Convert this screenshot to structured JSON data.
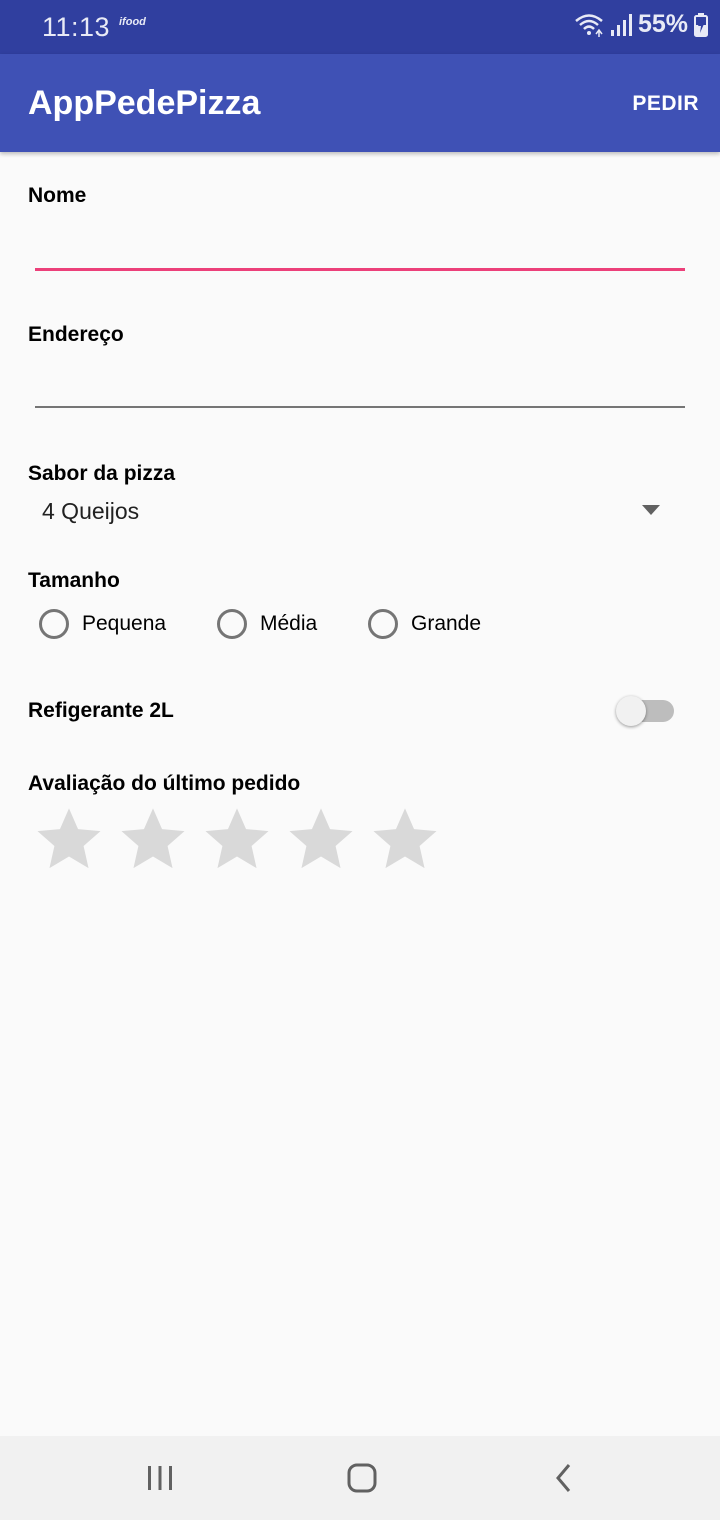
{
  "status_bar": {
    "time": "11:13",
    "notification_app": "ifood",
    "battery_percent": "55%",
    "icons": [
      "wifi-icon",
      "signal-icon",
      "battery-charging-icon"
    ]
  },
  "app_bar": {
    "title": "AppPedePizza",
    "action_label": "PEDIR"
  },
  "form": {
    "name_label": "Nome",
    "name_value": "",
    "address_label": "Endereço",
    "address_value": "",
    "flavor_label": "Sabor da pizza",
    "flavor_selected": "4 Queijos",
    "size_label": "Tamanho",
    "size_options": [
      "Pequena",
      "Média",
      "Grande"
    ],
    "size_selected": null,
    "soda_label": "Refigerante 2L",
    "soda_enabled": false,
    "rating_label": "Avaliação do último pedido",
    "rating_value": 0,
    "rating_max": 5
  },
  "colors": {
    "status_bar": "#303f9f",
    "app_bar": "#3f51b5",
    "accent": "#ec407a",
    "star_empty": "#d9d9d9"
  }
}
